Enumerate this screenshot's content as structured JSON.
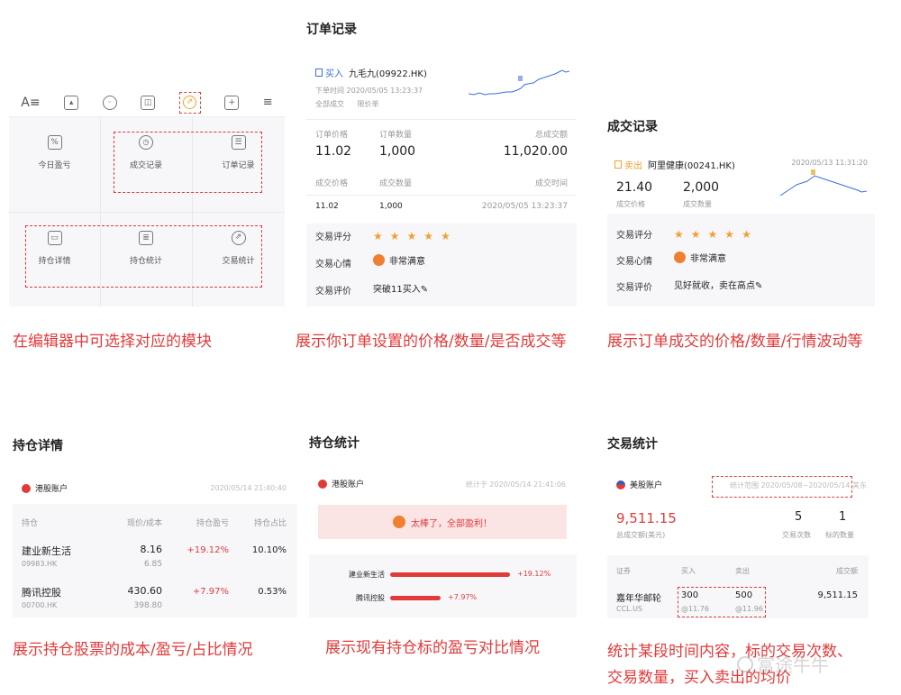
{
  "editor": {
    "toolbar_icons": [
      "text-format-icon",
      "image-icon",
      "emoji-icon",
      "video-icon",
      "trade-icon",
      "add-icon",
      "more-icon"
    ],
    "modules": [
      {
        "label": "今日盈亏",
        "icon": "%"
      },
      {
        "label": "成交记录",
        "icon": "clock"
      },
      {
        "label": "订单记录",
        "icon": "list"
      },
      {
        "label": "持仓详情",
        "icon": "wallet"
      },
      {
        "label": "持仓统计",
        "icon": "doc"
      },
      {
        "label": "交易统计",
        "icon": "trade"
      }
    ],
    "caption": "在编辑器中可选择对应的模块"
  },
  "order": {
    "title": "订单记录",
    "side": "买入",
    "stock": "九毛九(09922.HK)",
    "order_time": "下单时间 2020/05/05 13:23:37",
    "status1": "全部成交",
    "status2": "限价单",
    "h_price": "订单价格",
    "h_qty": "订单数量",
    "h_total": "总成交额",
    "price": "11.02",
    "qty": "1,000",
    "total": "11,020.00",
    "h_deal_price": "成交价格",
    "h_deal_qty": "成交数量",
    "h_deal_time": "成交时间",
    "deal_price": "11.02",
    "deal_qty": "1,000",
    "deal_time": "2020/05/05 13:23:37",
    "rating_label": "交易评分",
    "mood_label": "交易心情",
    "mood": "非常满意",
    "comment_label": "交易评价",
    "comment": "突破11买入",
    "caption": "展示你订单设置的价格/数量/是否成交等"
  },
  "deal": {
    "title": "成交记录",
    "side": "卖出",
    "stock": "阿里健康(00241.HK)",
    "time": "2020/05/13 11:31:20",
    "price": "21.40",
    "price_label": "成交价格",
    "qty": "2,000",
    "qty_label": "成交数量",
    "rating_label": "交易评分",
    "mood_label": "交易心情",
    "mood": "非常满意",
    "comment_label": "交易评价",
    "comment": "见好就收，卖在高点",
    "caption": "展示订单成交的价格/数量/行情波动等"
  },
  "holding": {
    "title": "持仓详情",
    "account": "港股账户",
    "time": "2020/05/14 21:40:40",
    "headers": [
      "持仓",
      "现价/成本",
      "持仓盈亏",
      "持仓占比"
    ],
    "rows": [
      {
        "name": "建业新生活",
        "code": "09983.HK",
        "price": "8.16",
        "cost": "6.85",
        "pnl": "+19.12%",
        "ratio": "10.10%"
      },
      {
        "name": "腾讯控股",
        "code": "00700.HK",
        "price": "430.60",
        "cost": "398.80",
        "pnl": "+7.97%",
        "ratio": "0.53%"
      }
    ],
    "caption": "展示持仓股票的成本/盈亏/占比情况"
  },
  "holding_stats": {
    "title": "持仓统计",
    "account": "港股账户",
    "time": "统计于 2020/05/14 21:41:06",
    "banner": "太棒了，全部盈利！",
    "bars": [
      {
        "name": "建业新生活",
        "value": "+19.12%",
        "fraction": 1.0
      },
      {
        "name": "腾讯控股",
        "value": "+7.97%",
        "fraction": 0.42
      }
    ],
    "caption": "展示现有持仓标的盈亏对比情况"
  },
  "trade_stats": {
    "title": "交易统计",
    "account": "美股账户",
    "range": "统计范围 2020/05/08~2020/05/14 美东",
    "total": "9,511.15",
    "total_label": "总成交额(美元)",
    "count": "5",
    "count_label": "交易次数",
    "symbols": "1",
    "symbols_label": "标的数量",
    "h_sec": "证券",
    "h_buy": "买入",
    "h_sell": "卖出",
    "h_amount": "成交额",
    "name": "嘉年华邮轮",
    "code": "CCL.US",
    "buy_qty": "300",
    "buy_price": "@11.76",
    "sell_qty": "500",
    "sell_price": "@11.96",
    "amount": "9,511.15",
    "caption1": "统计某段时间内容，标的交易次数、",
    "caption2": "交易数量，买入卖出的均价"
  },
  "watermark": "富途牛牛",
  "colors": {
    "accent": "#e03a3a",
    "up": "#e03a3a",
    "chart": "#3a6fd8",
    "star": "#f0a030"
  }
}
